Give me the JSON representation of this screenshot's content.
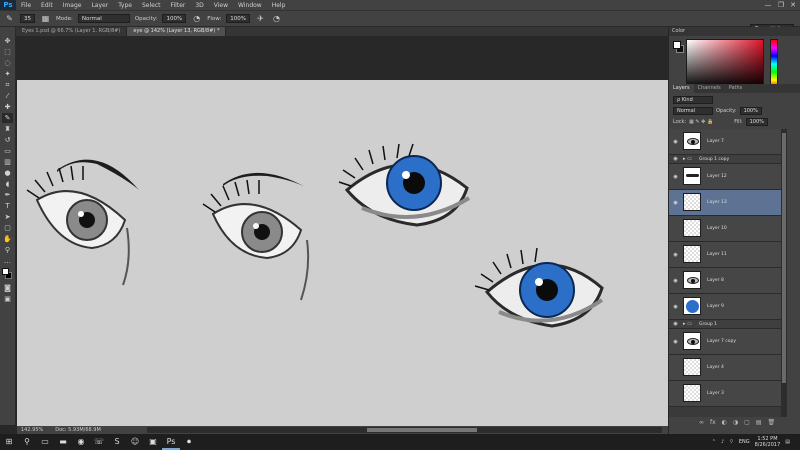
{
  "app": {
    "logo": "Ps",
    "menu": [
      "File",
      "Edit",
      "Image",
      "Layer",
      "Type",
      "Select",
      "Filter",
      "3D",
      "View",
      "Window",
      "Help"
    ],
    "window_controls": [
      "—",
      "❐",
      "✕"
    ]
  },
  "options_bar": {
    "brush_size": "35",
    "mode_label": "Mode:",
    "mode_value": "Normal",
    "opacity_label": "Opacity:",
    "opacity_value": "100%",
    "flow_label": "Flow:",
    "flow_value": "100%",
    "workspace": "Essentials"
  },
  "tabs": [
    {
      "label": "Eyes 1.psd @ 66.7% (Layer 1, RGB/8#)",
      "active": false
    },
    {
      "label": "eye @ 142% (Layer 13, RGB/8#) *",
      "active": true
    }
  ],
  "status_bar": {
    "zoom": "142.95%",
    "doc": "Doc: 5.93M/68.9M"
  },
  "color_panel": {
    "title": "Color",
    "accent": "#e0142b"
  },
  "layers_panel": {
    "tabs": [
      "Layers",
      "Channels",
      "Paths"
    ],
    "filter_kind": "ρ Kind",
    "blend_mode": "Normal",
    "opacity_label": "Opacity:",
    "opacity_value": "100%",
    "lock_label": "Lock:",
    "fill_label": "Fill:",
    "fill_value": "100%",
    "layers": [
      {
        "name": "Layer 7",
        "visible": true,
        "type": "layer",
        "thumb": "eye-bw"
      },
      {
        "name": "Group 1 copy",
        "visible": true,
        "type": "group"
      },
      {
        "name": "Layer 12",
        "visible": true,
        "type": "layer",
        "thumb": "lash"
      },
      {
        "name": "Layer 13",
        "visible": true,
        "type": "layer",
        "thumb": "checker",
        "selected": true
      },
      {
        "name": "Layer 10",
        "visible": false,
        "type": "layer",
        "thumb": "checker"
      },
      {
        "name": "Layer 11",
        "visible": true,
        "type": "layer",
        "thumb": "checker"
      },
      {
        "name": "Layer 8",
        "visible": true,
        "type": "layer",
        "thumb": "eye-small"
      },
      {
        "name": "Layer 9",
        "visible": true,
        "type": "layer",
        "thumb": "blue-circle"
      },
      {
        "name": "Group 1",
        "visible": true,
        "type": "group"
      },
      {
        "name": "Layer 7 copy",
        "visible": true,
        "type": "layer",
        "thumb": "eye-bw"
      },
      {
        "name": "Layer 4",
        "visible": false,
        "type": "layer",
        "thumb": "checker"
      },
      {
        "name": "Layer 3",
        "visible": false,
        "type": "layer",
        "thumb": "checker"
      }
    ],
    "footer_icons": [
      "∞",
      "fx",
      "◐",
      "◑",
      "▢",
      "▤",
      "🗑"
    ]
  },
  "taskbar": {
    "language": "ENG",
    "time": "1:52 PM",
    "date": "8/26/2017"
  },
  "colors": {
    "iris_blue": "#2b6fc9",
    "selected_layer": "#5e7393"
  }
}
